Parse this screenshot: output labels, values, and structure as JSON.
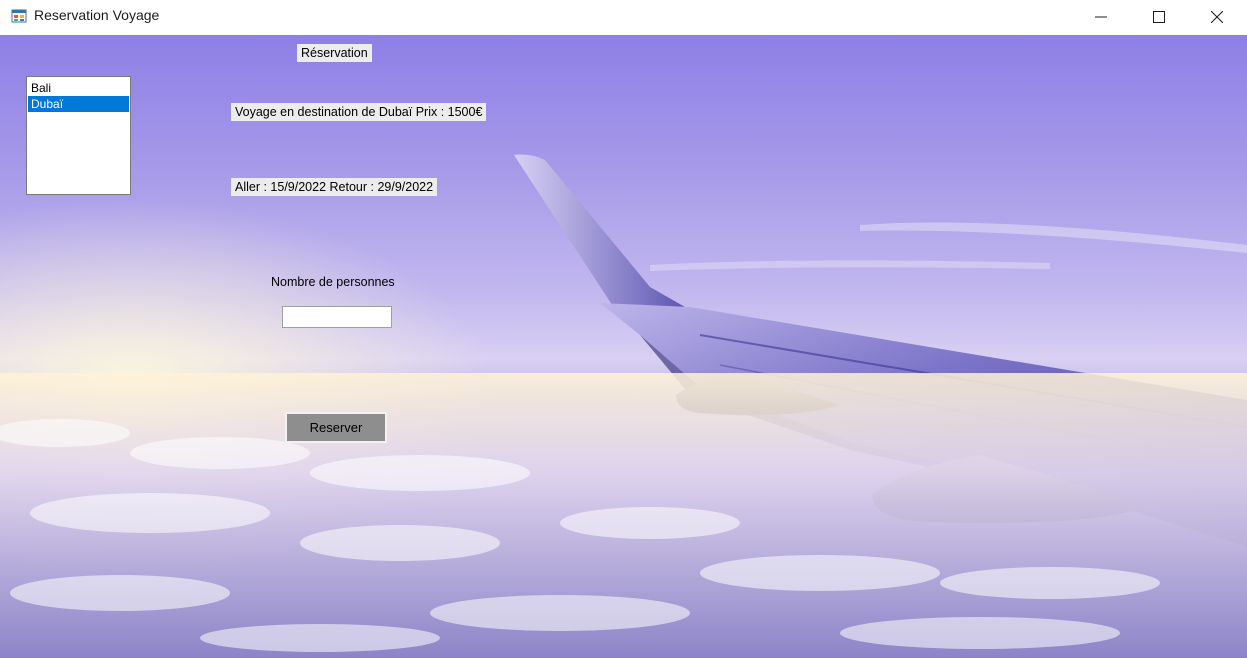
{
  "window": {
    "title": "Reservation Voyage"
  },
  "destinations": {
    "items": [
      "Bali",
      "Dubaï"
    ],
    "selected": "Dubaï"
  },
  "labels": {
    "heading": "Réservation",
    "trip_info": "Voyage en destination de Dubaï Prix : 1500€",
    "dates": "Aller : 15/9/2022 Retour : 29/9/2022",
    "persons_label": "Nombre de personnes"
  },
  "form": {
    "persons_value": "",
    "reserve_button": "Reserver"
  },
  "colors": {
    "selection": "#0078d7"
  }
}
